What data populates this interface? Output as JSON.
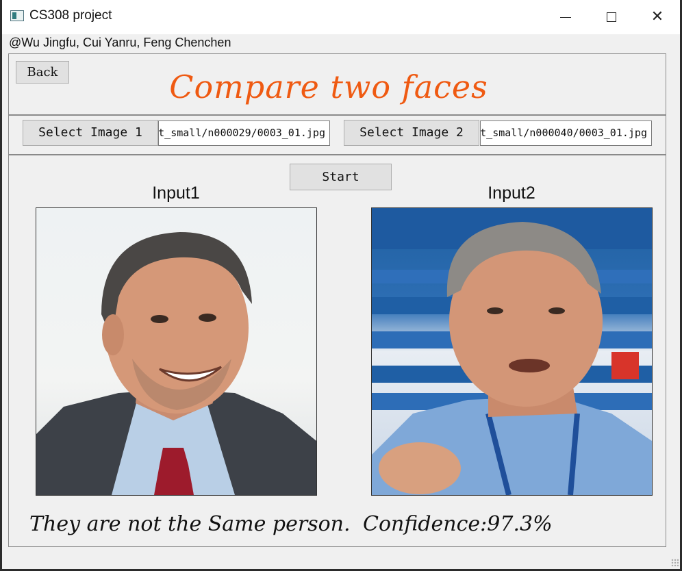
{
  "window": {
    "title": "CS308 project",
    "controls": [
      "minimize",
      "maximize",
      "close"
    ]
  },
  "authors": "@Wu Jingfu, Cui Yanru, Feng Chenchen",
  "header": {
    "back_label": "Back",
    "heading": "Compare two faces",
    "heading_color": "#ef5a12"
  },
  "selectors": {
    "image1_button": "Select Image 1",
    "image1_path": "t_small/n000029/0003_01.jpg",
    "image2_button": "Select Image 2",
    "image2_path": "t_small/n000040/0003_01.jpg"
  },
  "main": {
    "start_label": "Start",
    "input1_label": "Input1",
    "input2_label": "Input2",
    "result_text": "They are not the Same person.",
    "confidence_text": "Confidence:97.3%"
  }
}
